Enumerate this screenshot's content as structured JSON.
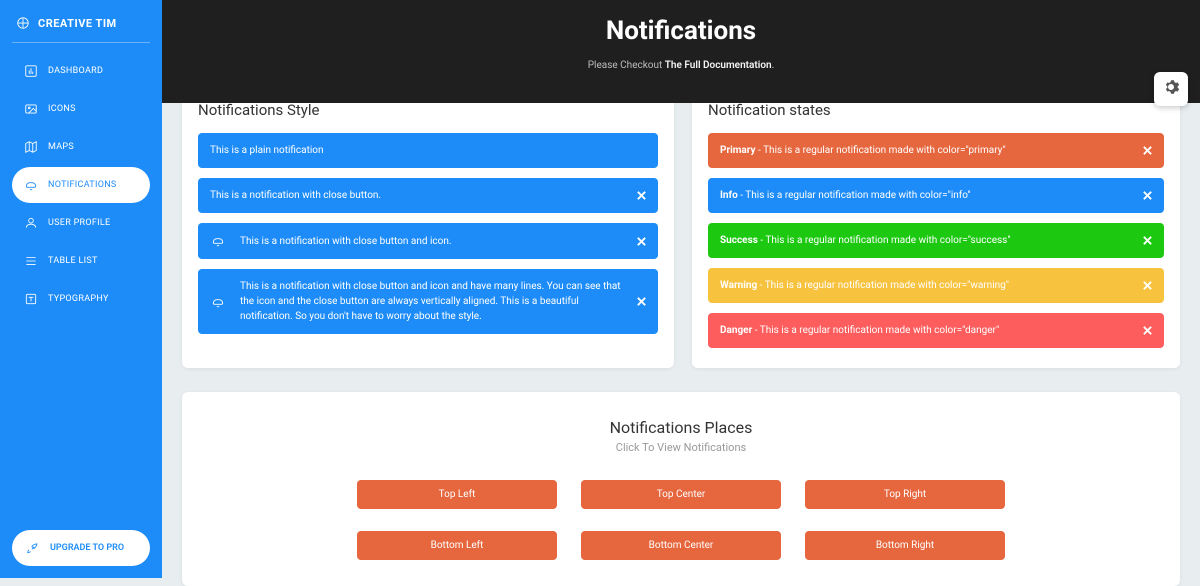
{
  "brand": "CREATIVE TIM",
  "sidebar": {
    "items": [
      {
        "label": "DASHBOARD"
      },
      {
        "label": "ICONS"
      },
      {
        "label": "MAPS"
      },
      {
        "label": "NOTIFICATIONS"
      },
      {
        "label": "USER PROFILE"
      },
      {
        "label": "TABLE LIST"
      },
      {
        "label": "TYPOGRAPHY"
      }
    ],
    "upgrade": "UPGRADE TO PRO"
  },
  "header": {
    "title": "Notifications",
    "subtitle_pre": "Please Checkout ",
    "subtitle_link": "The Full Documentation",
    "subtitle_suf": "."
  },
  "style_card": {
    "title": "Notifications Style",
    "alerts": {
      "plain": "This is a plain notification",
      "close": "This is a notification with close button.",
      "icon": "This is a notification with close button and icon.",
      "long": "This is a notification with close button and icon and have many lines. You can see that the icon and the close button are always vertically aligned. This is a beautiful notification. So you don't have to worry about the style."
    }
  },
  "states_card": {
    "title": "Notification states",
    "items": [
      {
        "label": "Primary",
        "text": " - This is a regular notification made with color=\"primary\""
      },
      {
        "label": "Info",
        "text": " - This is a regular notification made with color=\"info\""
      },
      {
        "label": "Success",
        "text": " - This is a regular notification made with color=\"success\""
      },
      {
        "label": "Warning",
        "text": " - This is a regular notification made with color=\"warning\""
      },
      {
        "label": "Danger",
        "text": " - This is a regular notification made with color=\"danger\""
      }
    ]
  },
  "places": {
    "title": "Notifications Places",
    "subtitle": "Click To View Notifications",
    "buttons": [
      "Top Left",
      "Top Center",
      "Top Right",
      "Bottom Left",
      "Bottom Center",
      "Bottom Right"
    ]
  }
}
